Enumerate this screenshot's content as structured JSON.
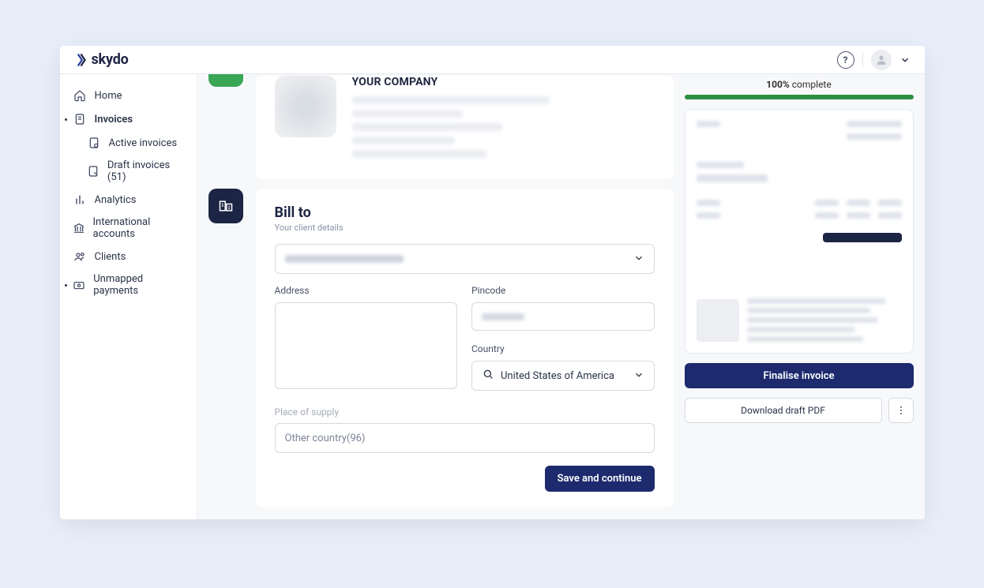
{
  "brand": {
    "name": "skydo"
  },
  "sidebar": {
    "items": [
      {
        "label": "Home"
      },
      {
        "label": "Invoices"
      },
      {
        "label": "Active invoices"
      },
      {
        "label": "Draft invoices (51)"
      },
      {
        "label": "Analytics"
      },
      {
        "label": "International accounts"
      },
      {
        "label": "Clients"
      },
      {
        "label": "Unmapped payments"
      }
    ]
  },
  "company": {
    "heading": "YOUR COMPANY"
  },
  "billto": {
    "title": "Bill to",
    "subtitle": "Your client details",
    "address_label": "Address",
    "pincode_label": "Pincode",
    "country_label": "Country",
    "country_value": "United States of America",
    "supply_label": "Place of supply",
    "supply_value": "Other country(96)",
    "save_label": "Save and continue"
  },
  "right": {
    "progress_percent": "100%",
    "progress_label": "complete",
    "finalise_label": "Finalise invoice",
    "download_label": "Download draft PDF"
  }
}
